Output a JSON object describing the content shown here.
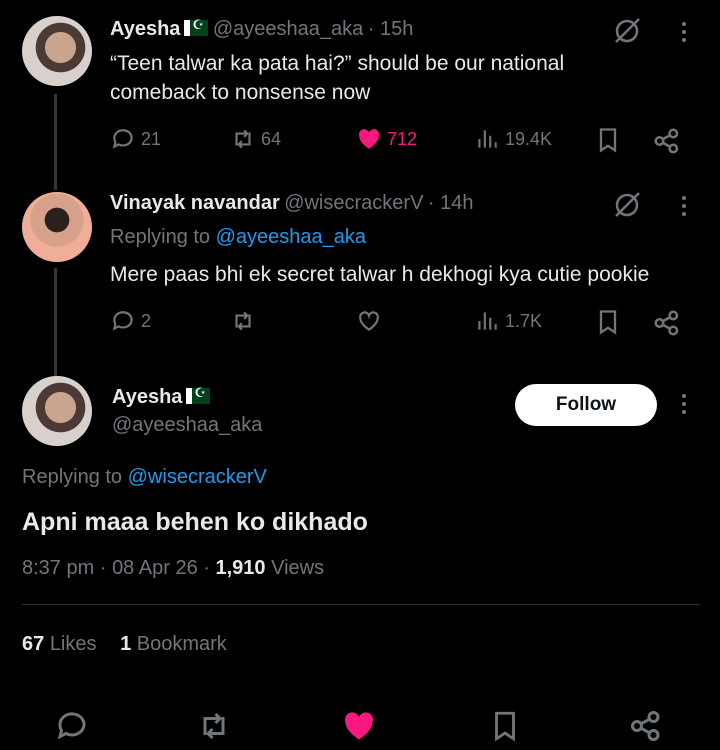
{
  "tweet1": {
    "name": "Ayesha",
    "handle": "@ayeeshaa_aka",
    "time": "· 15h",
    "text_line1": "“Teen talwar ka pata hai?” should be our national",
    "text_line2": "comeback to nonsense now",
    "replies": "21",
    "reposts": "64",
    "likes": "712",
    "views": "19.4K",
    "like_color": "#f91880"
  },
  "tweet2": {
    "name": "Vinayak navandar",
    "handle": "@wisecrackerV",
    "time": "· 14h",
    "replying_prefix": "Replying to",
    "replying_to": "@ayeeshaa_aka",
    "text": "Mere paas bhi ek secret talwar h dekhogi kya cutie pookie",
    "replies": "2",
    "views": "1.7K"
  },
  "main_tweet": {
    "name": "Ayesha",
    "handle": "@ayeeshaa_aka",
    "follow_label": "Follow",
    "replying_prefix": "Replying to",
    "replying_to": "@wisecrackerV",
    "text": "Apni maaa behen ko dikhado",
    "time": "8:37 pm",
    "date": "08 Apr 26",
    "views_count": "1,910",
    "views_label": "Views",
    "likes_count": "67",
    "likes_label": "Likes",
    "bookmarks_count": "1",
    "bookmarks_label": "Bookmark"
  },
  "icons": [
    "reply-icon",
    "repost-icon",
    "like-icon",
    "views-icon",
    "bookmark-icon",
    "share-icon",
    "grok-icon",
    "more-icon",
    "pakistan-flag-icon"
  ],
  "colors": {
    "background": "#000000",
    "text": "#e7e9ea",
    "muted": "#71767b",
    "link": "#1d9bf0",
    "like": "#f91880"
  }
}
